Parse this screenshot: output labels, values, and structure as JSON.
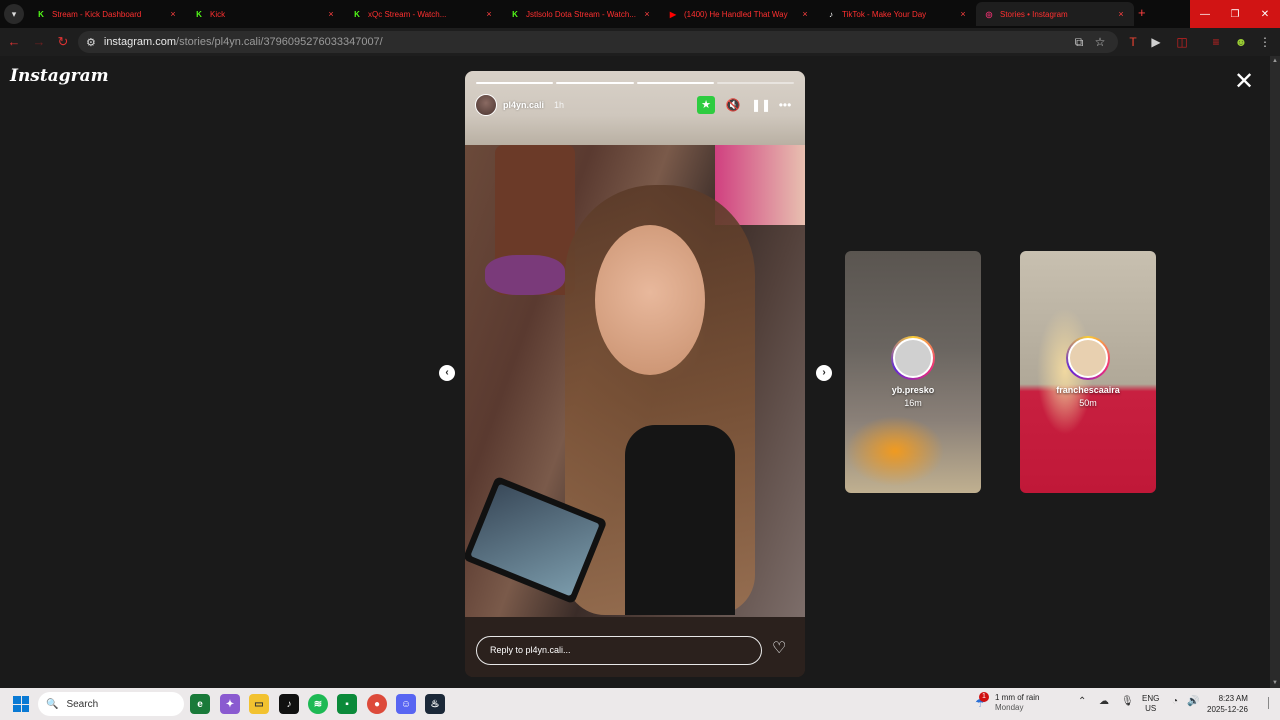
{
  "browser": {
    "tabs": [
      {
        "title": "Stream - Kick Dashboard",
        "favicon": "kick-icon",
        "color": "#53fc18"
      },
      {
        "title": "Kick",
        "favicon": "kick-icon",
        "color": "#53fc18"
      },
      {
        "title": "xQc Stream - Watch...",
        "favicon": "kick-icon",
        "color": "#53fc18"
      },
      {
        "title": "Jstlsolo Dota Stream - Watch...",
        "favicon": "kick-icon",
        "color": "#53fc18"
      },
      {
        "title": "(1400) He Handled That Way",
        "favicon": "youtube-icon",
        "color": "#ff0000"
      },
      {
        "title": "TikTok - Make Your Day",
        "favicon": "tiktok-icon",
        "color": "#ffffff"
      },
      {
        "title": "Stories • Instagram",
        "favicon": "instagram-icon",
        "color": "#e1306c"
      }
    ],
    "active_tab": 6,
    "new_tab_label": "+",
    "window_controls": {
      "minimize": "—",
      "maximize": "❐",
      "close": "✕"
    },
    "url_host": "instagram.com",
    "url_path": "/stories/pl4yn.cali/3796095276033347007/"
  },
  "instagram": {
    "logo": "Instagram",
    "close_label": "✕",
    "story": {
      "username": "pl4yn.cali",
      "time": "1h",
      "progress_segments": 4,
      "progress_done": 3,
      "reply_placeholder": "Reply to pl4yn.cali...",
      "star_label": "★",
      "mute_label": "🔇",
      "pause_label": "❚❚",
      "more_label": "•••",
      "heart_label": "♡"
    },
    "prev_arrow": "‹",
    "next_arrow": "›",
    "upcoming": [
      {
        "username": "yb.presko",
        "time": "16m"
      },
      {
        "username": "franchescaaira",
        "time": "50m"
      }
    ]
  },
  "taskbar": {
    "search_placeholder": "Search",
    "weather_line1": "1 mm of rain",
    "weather_line2": "Monday",
    "weather_badge": "1",
    "lang_line1": "ENG",
    "lang_line2": "US",
    "time": "8:23 AM",
    "date": "2025-12-26"
  }
}
